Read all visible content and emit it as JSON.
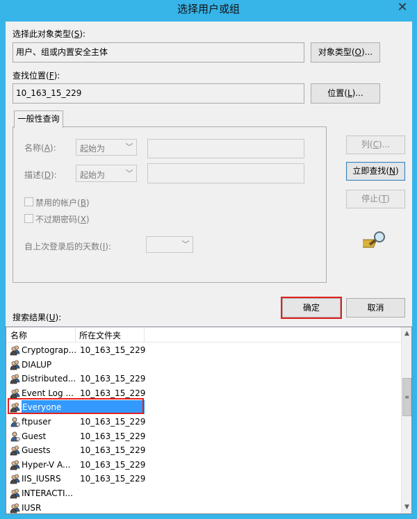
{
  "window": {
    "title": "选择用户或组",
    "close_glyph": "✕"
  },
  "object_type": {
    "label": "选择此对象类型(",
    "label_key": "S",
    "label_end": "):",
    "value": "用户、组或内置安全主体",
    "button_text": "对象类型(",
    "button_key": "O",
    "button_end": ")..."
  },
  "location": {
    "label": "查找位置(",
    "label_key": "F",
    "label_end": "):",
    "value": "10_163_15_229",
    "button_text": "位置(",
    "button_key": "L",
    "button_end": ")..."
  },
  "query": {
    "tab_label": "一般性查询",
    "name_label": "名称(",
    "name_key": "A",
    "name_end": "):",
    "name_mode": "起始为",
    "desc_label": "描述(",
    "desc_key": "D",
    "desc_end": "):",
    "desc_mode": "起始为",
    "disabled_accounts": "禁用的帐户(",
    "disabled_key": "B",
    "disabled_end": ")",
    "non_expiring": "不过期密码(",
    "non_expiring_key": "X",
    "non_expiring_end": ")",
    "days_label": "自上次登录后的天数(",
    "days_key": "I",
    "days_end": "):"
  },
  "side_buttons": {
    "columns": "列(",
    "columns_key": "C",
    "columns_end": ")...",
    "find_now": "立即查找(",
    "find_now_key": "N",
    "find_now_end": ")",
    "stop": "停止(",
    "stop_key": "T",
    "stop_end": ")",
    "search_icon": "magnifier-search-icon"
  },
  "dialog_buttons": {
    "ok": "确定",
    "cancel": "取消"
  },
  "results": {
    "label": "搜索结果(",
    "label_key": "U",
    "label_end": "):",
    "columns": [
      "名称",
      "所在文件夹"
    ],
    "rows": [
      {
        "name": "Cryptograp...",
        "folder": "10_163_15_229",
        "icon": "group-icon"
      },
      {
        "name": "DIALUP",
        "folder": "",
        "icon": "group-icon"
      },
      {
        "name": "Distributed...",
        "folder": "10_163_15_229",
        "icon": "group-icon"
      },
      {
        "name": "Event Log ...",
        "folder": "10_163_15_229",
        "icon": "group-icon"
      },
      {
        "name": "Everyone",
        "folder": "",
        "icon": "group-icon",
        "selected": true
      },
      {
        "name": "ftpuser",
        "folder": "10_163_15_229",
        "icon": "user-icon"
      },
      {
        "name": "Guest",
        "folder": "10_163_15_229",
        "icon": "user-icon"
      },
      {
        "name": "Guests",
        "folder": "10_163_15_229",
        "icon": "group-icon"
      },
      {
        "name": "Hyper-V A...",
        "folder": "10_163_15_229",
        "icon": "group-icon"
      },
      {
        "name": "IIS_IUSRS",
        "folder": "10_163_15_229",
        "icon": "group-icon"
      },
      {
        "name": "INTERACTI...",
        "folder": "",
        "icon": "group-icon"
      },
      {
        "name": "IUSR",
        "folder": "",
        "icon": "group-icon"
      }
    ]
  },
  "colors": {
    "frame": "#37b4e8",
    "highlight": "#3399ff",
    "annotation": "#e0201e"
  }
}
